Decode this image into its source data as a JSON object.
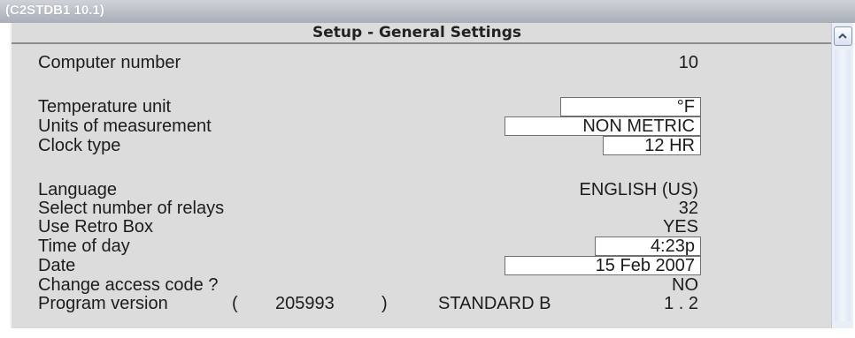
{
  "titlebar": {
    "text": "(C2STDB1 10.1)"
  },
  "dialog": {
    "title": "Setup - General Settings"
  },
  "settings": {
    "computer_number": {
      "label": "Computer number",
      "value": "10"
    },
    "temperature_unit": {
      "label": "Temperature unit",
      "value": "°F"
    },
    "units_of_measurement": {
      "label": "Units of measurement",
      "value": "NON METRIC"
    },
    "clock_type": {
      "label": "Clock type",
      "value": "12 HR"
    },
    "language": {
      "label": "Language",
      "value": "ENGLISH (US)"
    },
    "number_of_relays": {
      "label": "Select number of relays",
      "value": "32"
    },
    "retro_box": {
      "label": "Use Retro Box",
      "value": "YES"
    },
    "time_of_day": {
      "label": "Time of day",
      "value": "4:23p"
    },
    "date": {
      "label": "Date",
      "value": "15 Feb 2007"
    },
    "access_code": {
      "label": "Change access code ?",
      "value": "NO"
    },
    "program_version": {
      "label": "Program version",
      "open_paren": "(",
      "number": "205993",
      "close_paren": ")",
      "edition": "STANDARD B",
      "version": "1 . 2"
    }
  },
  "scrollbar": {
    "up_icon": "chevron-up-icon"
  },
  "colors": {
    "titlebar": "#b8bcc3",
    "panel": "#dcdcdc",
    "field_bg": "#ffffff",
    "text": "#1c1c1c"
  }
}
